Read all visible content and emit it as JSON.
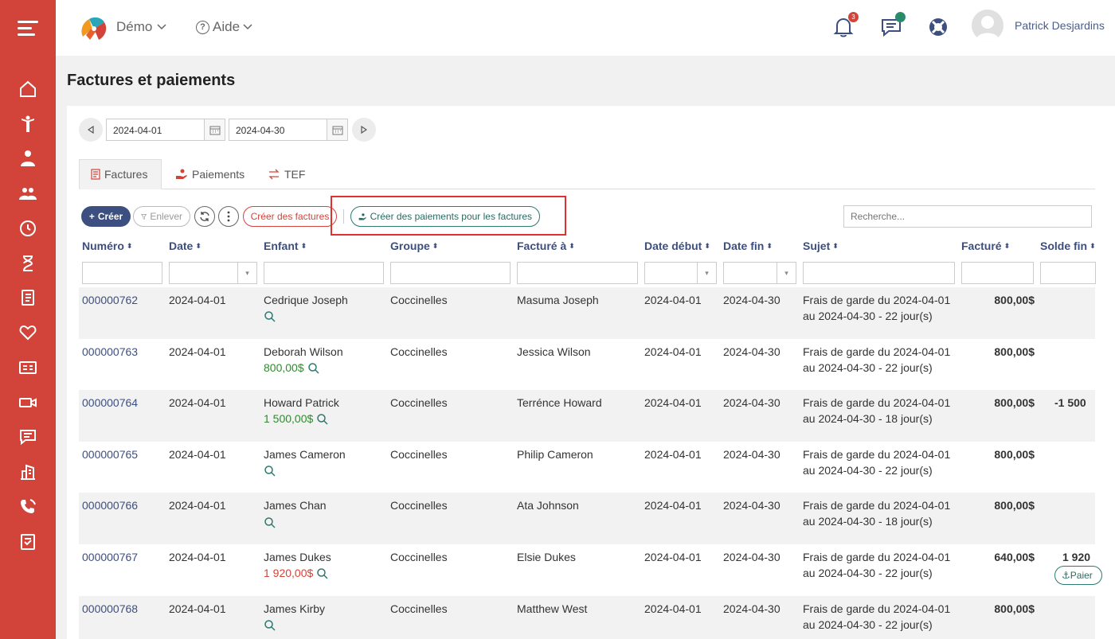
{
  "topbar": {
    "org_name": "Démo",
    "help_label": "Aide",
    "notifications_count": "3",
    "messages_count": "9",
    "user_name": "Patrick Desjardins"
  },
  "page": {
    "title": "Factures et paiements"
  },
  "date_range": {
    "start": "2024-04-01",
    "end": "2024-04-30"
  },
  "tabs": [
    {
      "label": "Factures",
      "icon": "invoice-icon",
      "active": true
    },
    {
      "label": "Paiements",
      "icon": "payment-hand-icon",
      "active": false
    },
    {
      "label": "TEF",
      "icon": "transfer-icon",
      "active": false
    }
  ],
  "toolbar": {
    "create_label": "Créer",
    "remove_label": "Enlever",
    "create_invoices_label": "Créer des factures",
    "create_payments_label": "Créer des paiements pour les factures",
    "search_placeholder": "Recherche..."
  },
  "table": {
    "columns": [
      "Numéro",
      "Date",
      "Enfant",
      "Groupe",
      "Facturé à",
      "Date début",
      "Date fin",
      "Sujet",
      "Facturé",
      "Solde fin"
    ],
    "rows": [
      {
        "numero": "000000762",
        "date": "2024-04-01",
        "enfant": "Cedrique Joseph",
        "enfant_amount": "",
        "amount_color": "",
        "groupe": "Coccinelles",
        "facture_a": "Masuma Joseph",
        "debut": "2024-04-01",
        "fin": "2024-04-30",
        "sujet_1": "Frais de garde du 2024-04-01",
        "sujet_2": "au 2024-04-30 - 22 jour(s)",
        "facture": "800,00$",
        "solde": ""
      },
      {
        "numero": "000000763",
        "date": "2024-04-01",
        "enfant": "Deborah Wilson",
        "enfant_amount": "800,00$",
        "amount_color": "green",
        "groupe": "Coccinelles",
        "facture_a": "Jessica Wilson",
        "debut": "2024-04-01",
        "fin": "2024-04-30",
        "sujet_1": "Frais de garde du 2024-04-01",
        "sujet_2": "au 2024-04-30 - 22 jour(s)",
        "facture": "800,00$",
        "solde": ""
      },
      {
        "numero": "000000764",
        "date": "2024-04-01",
        "enfant": "Howard Patrick",
        "enfant_amount": "1 500,00$",
        "amount_color": "green",
        "groupe": "Coccinelles",
        "facture_a": "Terrénce Howard",
        "debut": "2024-04-01",
        "fin": "2024-04-30",
        "sujet_1": "Frais de garde du 2024-04-01",
        "sujet_2": "au 2024-04-30 - 18 jour(s)",
        "facture": "800,00$",
        "solde": "-1 500"
      },
      {
        "numero": "000000765",
        "date": "2024-04-01",
        "enfant": "James Cameron",
        "enfant_amount": "",
        "amount_color": "",
        "groupe": "Coccinelles",
        "facture_a": "Philip Cameron",
        "debut": "2024-04-01",
        "fin": "2024-04-30",
        "sujet_1": "Frais de garde du 2024-04-01",
        "sujet_2": "au 2024-04-30 - 22 jour(s)",
        "facture": "800,00$",
        "solde": ""
      },
      {
        "numero": "000000766",
        "date": "2024-04-01",
        "enfant": "James Chan",
        "enfant_amount": "",
        "amount_color": "",
        "groupe": "Coccinelles",
        "facture_a": "Ata Johnson",
        "debut": "2024-04-01",
        "fin": "2024-04-30",
        "sujet_1": "Frais de garde du 2024-04-01",
        "sujet_2": "au 2024-04-30 - 18 jour(s)",
        "facture": "800,00$",
        "solde": ""
      },
      {
        "numero": "000000767",
        "date": "2024-04-01",
        "enfant": "James Dukes",
        "enfant_amount": "1 920,00$",
        "amount_color": "red",
        "groupe": "Coccinelles",
        "facture_a": "Elsie Dukes",
        "debut": "2024-04-01",
        "fin": "2024-04-30",
        "sujet_1": "Frais de garde du 2024-04-01",
        "sujet_2": "au 2024-04-30 - 22 jour(s)",
        "facture": "640,00$",
        "solde": "1 920",
        "pay_button": "Paier"
      },
      {
        "numero": "000000768",
        "date": "2024-04-01",
        "enfant": "James Kirby",
        "enfant_amount": "",
        "amount_color": "",
        "groupe": "Coccinelles",
        "facture_a": "Matthew West",
        "debut": "2024-04-01",
        "fin": "2024-04-30",
        "sujet_1": "Frais de garde du 2024-04-01",
        "sujet_2": "au 2024-04-30 - 22 jour(s)",
        "facture": "800,00$",
        "solde": ""
      }
    ]
  },
  "colors": {
    "sidebar": "#d2443a",
    "primary": "#3d4f80",
    "teal": "#2a7a70",
    "green": "#2e8b2e",
    "red": "#d2443a"
  },
  "sidebar_icons": [
    "home-icon",
    "child-icon",
    "staff-icon",
    "group-icon",
    "clock-icon",
    "hourglass-icon",
    "invoice-list-icon",
    "heart-icon",
    "id-card-icon",
    "video-icon",
    "chat-icon",
    "building-icon",
    "phone-icon",
    "report-icon"
  ]
}
